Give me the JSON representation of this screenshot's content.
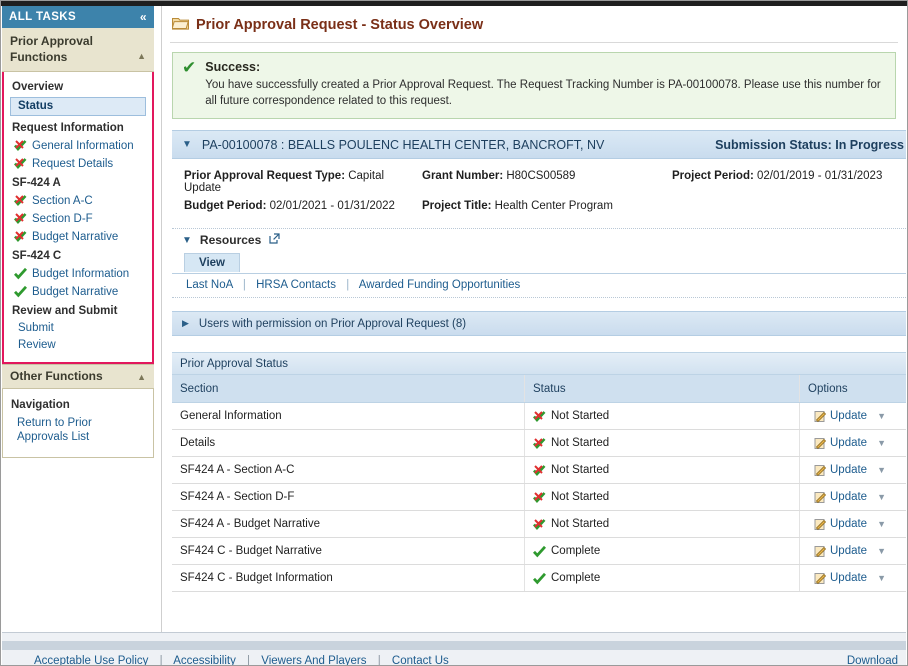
{
  "sidebar": {
    "header": {
      "title": "ALL TASKS",
      "collapse_icon": "double-chevron-left-icon"
    },
    "functions_header": {
      "line1": "Prior Approval",
      "line2": "Functions",
      "toggle_icon": "triangle-up-icon"
    },
    "groups": [
      {
        "label": "Overview",
        "items": [
          {
            "label": "Status",
            "icon": "none",
            "selected": true
          }
        ]
      },
      {
        "label": "Request Information",
        "items": [
          {
            "label": "General Information",
            "icon": "check-x-icon",
            "selected": false
          },
          {
            "label": "Request Details",
            "icon": "check-x-icon",
            "selected": false
          }
        ]
      },
      {
        "label": "SF-424 A",
        "items": [
          {
            "label": "Section A-C",
            "icon": "check-x-icon",
            "selected": false
          },
          {
            "label": "Section D-F",
            "icon": "check-x-icon",
            "selected": false
          },
          {
            "label": "Budget Narrative",
            "icon": "check-x-icon",
            "selected": false
          }
        ]
      },
      {
        "label": "SF-424 C",
        "items": [
          {
            "label": "Budget Information",
            "icon": "check-icon",
            "selected": false
          },
          {
            "label": "Budget Narrative",
            "icon": "check-icon",
            "selected": false
          }
        ]
      },
      {
        "label": "Review and Submit",
        "items": [
          {
            "label": "Submit",
            "icon": "none",
            "selected": false
          },
          {
            "label": "Review",
            "icon": "none",
            "selected": false
          }
        ]
      }
    ],
    "other_functions": {
      "header": "Other Functions",
      "toggle_icon": "triangle-up-icon",
      "group_label": "Navigation",
      "items": [
        {
          "label": "Return to Prior Approvals List"
        }
      ]
    }
  },
  "main": {
    "page_title": "Prior Approval Request - Status Overview",
    "page_title_icon": "open-folder-icon",
    "success": {
      "icon": "green-check-icon",
      "title": "Success:",
      "message": "You have successfully created a Prior Approval Request. The Request Tracking Number is PA-00100078. Please use this number for all future correspondence related to this request."
    },
    "request_bar": {
      "toggle_icon": "triangle-down-icon",
      "title": "PA-00100078 : BEALLS POULENC HEALTH CENTER, BANCROFT, NV",
      "status": "Submission Status: In Progress"
    },
    "meta": [
      {
        "label": "Prior Approval Request Type:",
        "value": "Capital Update"
      },
      {
        "label": "Grant Number:",
        "value": "H80CS00589"
      },
      {
        "label": "Project Period:",
        "value": "02/01/2019 - 01/31/2023"
      },
      {
        "label": "Budget Period:",
        "value": "02/01/2021 - 01/31/2022"
      },
      {
        "label": "Project Title:",
        "value": "Health Center Program"
      }
    ],
    "resources": {
      "toggle_icon": "triangle-down-icon",
      "title": "Resources",
      "external_icon": "external-link-icon",
      "tab": "View",
      "links": [
        "Last NoA",
        "HRSA Contacts",
        "Awarded Funding Opportunities"
      ]
    },
    "users_bar": {
      "toggle_icon": "triangle-right-icon",
      "label": "Users with permission on Prior Approval Request (8)"
    },
    "status_table": {
      "caption": "Prior Approval Status",
      "columns": [
        "Section",
        "Status",
        "Options"
      ],
      "rows": [
        {
          "section": "General Information",
          "status": "Not Started",
          "status_icon": "check-x-icon",
          "option": "Update",
          "option_icon": "edit-note-icon",
          "caret_icon": "caret-down-icon"
        },
        {
          "section": "Details",
          "status": "Not Started",
          "status_icon": "check-x-icon",
          "option": "Update",
          "option_icon": "edit-note-icon",
          "caret_icon": "caret-down-icon"
        },
        {
          "section": "SF424 A - Section A-C",
          "status": "Not Started",
          "status_icon": "check-x-icon",
          "option": "Update",
          "option_icon": "edit-note-icon",
          "caret_icon": "caret-down-icon"
        },
        {
          "section": "SF424 A - Section D-F",
          "status": "Not Started",
          "status_icon": "check-x-icon",
          "option": "Update",
          "option_icon": "edit-note-icon",
          "caret_icon": "caret-down-icon"
        },
        {
          "section": "SF424 A - Budget Narrative",
          "status": "Not Started",
          "status_icon": "check-x-icon",
          "option": "Update",
          "option_icon": "edit-note-icon",
          "caret_icon": "caret-down-icon"
        },
        {
          "section": "SF424 C - Budget Narrative",
          "status": "Complete",
          "status_icon": "check-icon",
          "option": "Update",
          "option_icon": "edit-note-icon",
          "caret_icon": "caret-down-icon"
        },
        {
          "section": "SF424 C - Budget Information",
          "status": "Complete",
          "status_icon": "check-icon",
          "option": "Update",
          "option_icon": "edit-note-icon",
          "caret_icon": "caret-down-icon"
        }
      ]
    }
  },
  "footer": {
    "links": [
      "Acceptable Use Policy",
      "Accessibility",
      "Viewers And Players",
      "Contact Us"
    ],
    "right": "Download"
  },
  "colors": {
    "sidebar_header_blue": "#3d83ab",
    "highlight_red": "#e2185d",
    "title_brown": "#7a2f17",
    "link_blue": "#1d5c8e",
    "success_green": "#2f8f2f",
    "panel_blue": "#cadcee"
  }
}
